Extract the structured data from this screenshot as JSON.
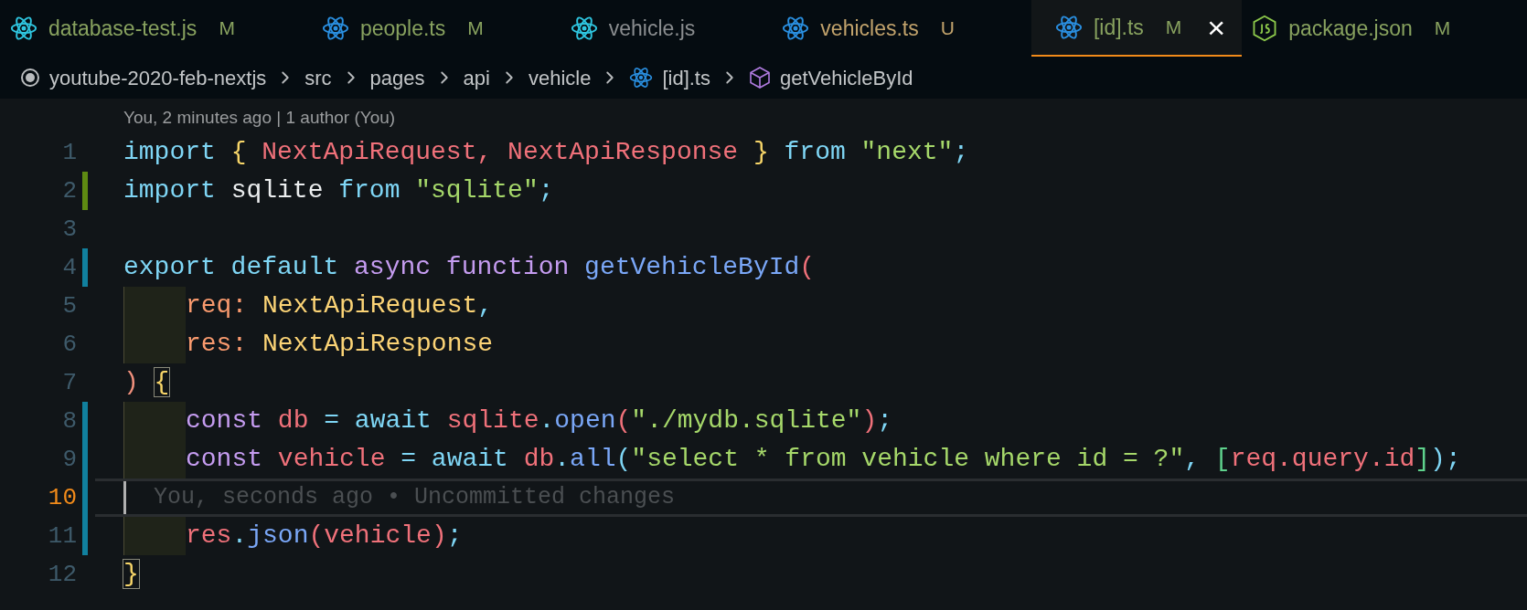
{
  "tabs": [
    {
      "label": "database-test.js",
      "status": "M",
      "kind": "jsx",
      "selected": false
    },
    {
      "label": "people.ts",
      "status": "M",
      "kind": "tsx",
      "selected": false
    },
    {
      "label": "vehicle.js",
      "kind": "jsx",
      "selected": false
    },
    {
      "label": "vehicles.ts",
      "status": "U",
      "kind": "tsx",
      "selected": false
    },
    {
      "label": "[id].ts",
      "status": "M",
      "kind": "tsx",
      "selected": true,
      "close": "×"
    },
    {
      "label": "package.json",
      "status": "M",
      "kind": "node",
      "selected": false
    }
  ],
  "breadcrumb": [
    {
      "label": "youtube-2020-feb-nextjs",
      "kind": "root"
    },
    {
      "label": "src",
      "kind": "folder"
    },
    {
      "label": "pages",
      "kind": "folder"
    },
    {
      "label": "api",
      "kind": "folder"
    },
    {
      "label": "vehicle",
      "kind": "folder"
    },
    {
      "label": "[id].ts",
      "kind": "file"
    },
    {
      "label": "getVehicleById",
      "kind": "symbol"
    }
  ],
  "codelens": "You, 2 minutes ago | 1 author (You)",
  "lines": [
    {
      "number": "1",
      "kind": "unchanged",
      "indented": false,
      "current": false,
      "tokens": [
        {
          "text": "import ",
          "color": "#7fd6f5",
          "matched": false
        },
        {
          "text": "{ ",
          "color": "#f8d669",
          "matched": false
        },
        {
          "text": "NextApiRequest, NextApiResponse ",
          "color": "#f0717a",
          "matched": false
        },
        {
          "text": "} ",
          "color": "#f8d669",
          "matched": false
        },
        {
          "text": "from ",
          "color": "#7fd6f5",
          "matched": false
        },
        {
          "text": "\"next\"",
          "color": "#a6d86a",
          "matched": false
        },
        {
          "text": ";",
          "color": "#7fd6f5",
          "matched": false
        }
      ]
    },
    {
      "number": "2",
      "kind": "added",
      "indented": false,
      "current": false,
      "tokens": [
        {
          "text": "import ",
          "color": "#7fd6f5",
          "matched": false
        },
        {
          "text": "sqlite ",
          "color": "#eceeef",
          "matched": false
        },
        {
          "text": "from ",
          "color": "#7fd6f5",
          "matched": false
        },
        {
          "text": "\"sqlite\"",
          "color": "#a6d86a",
          "matched": false
        },
        {
          "text": ";",
          "color": "#7fd6f5",
          "matched": false
        }
      ]
    },
    {
      "number": "3",
      "kind": "unchanged",
      "indented": false,
      "current": false
    },
    {
      "number": "4",
      "kind": "modified",
      "indented": false,
      "current": false,
      "tokens": [
        {
          "text": "export default ",
          "color": "#7fd6f5",
          "matched": false
        },
        {
          "text": "async function ",
          "color": "#c59cf0",
          "matched": false
        },
        {
          "text": "getVehicleById",
          "color": "#7aa7f7",
          "matched": false
        },
        {
          "text": "(",
          "color": "#f0717a",
          "matched": false
        }
      ]
    },
    {
      "number": "5",
      "kind": "unchanged",
      "indented": true,
      "current": false,
      "tokens": [
        {
          "text": "req: ",
          "color": "#f99a6e",
          "matched": false
        },
        {
          "text": "NextApiRequest",
          "color": "#fcd476",
          "matched": false
        },
        {
          "text": ",",
          "color": "#7fd6f5",
          "matched": false
        }
      ]
    },
    {
      "number": "6",
      "kind": "unchanged",
      "indented": true,
      "current": false,
      "tokens": [
        {
          "text": "res: ",
          "color": "#f99a6e",
          "matched": false
        },
        {
          "text": "NextApiResponse",
          "color": "#fcd476",
          "matched": false
        }
      ]
    },
    {
      "number": "7",
      "kind": "unchanged",
      "indented": false,
      "current": false,
      "tokens": [
        {
          "text": ") ",
          "color": "#f0907c",
          "matched": false
        },
        {
          "text": "{",
          "color": "#f8d669",
          "matched": true
        }
      ]
    },
    {
      "number": "8",
      "kind": "modified",
      "indented": true,
      "current": false,
      "tokens": [
        {
          "text": "const ",
          "color": "#c59cf0",
          "matched": false
        },
        {
          "text": "db ",
          "color": "#f0717a",
          "matched": false
        },
        {
          "text": "= await ",
          "color": "#7fd6f5",
          "matched": false
        },
        {
          "text": "sqlite",
          "color": "#f0717a",
          "matched": false
        },
        {
          "text": ".",
          "color": "#7fd6f5",
          "matched": false
        },
        {
          "text": "open",
          "color": "#7aa7f7",
          "matched": false
        },
        {
          "text": "(",
          "color": "#f0717a",
          "matched": false
        },
        {
          "text": "\"./mydb.sqlite\"",
          "color": "#a6d86a",
          "matched": false
        },
        {
          "text": ")",
          "color": "#f0717a",
          "matched": false
        },
        {
          "text": ";",
          "color": "#7fd6f5",
          "matched": false
        }
      ]
    },
    {
      "number": "9",
      "kind": "modified",
      "indented": true,
      "current": false,
      "tokens": [
        {
          "text": "const ",
          "color": "#c59cf0",
          "matched": false
        },
        {
          "text": "vehicle ",
          "color": "#f0717a",
          "matched": false
        },
        {
          "text": "= await ",
          "color": "#7fd6f5",
          "matched": false
        },
        {
          "text": "db",
          "color": "#f0717a",
          "matched": false
        },
        {
          "text": ".",
          "color": "#7fd6f5",
          "matched": false
        },
        {
          "text": "all",
          "color": "#7aa7f7",
          "matched": false
        },
        {
          "text": "(",
          "color": "#7fd6f5",
          "matched": false
        },
        {
          "text": "\"select * from vehicle where id = ?\"",
          "color": "#a6d86a",
          "matched": false
        },
        {
          "text": ", ",
          "color": "#7fd6f5",
          "matched": false
        },
        {
          "text": "[",
          "color": "#5fd38d",
          "matched": false
        },
        {
          "text": "req.query.id",
          "color": "#f0717a",
          "matched": false
        },
        {
          "text": "]",
          "color": "#5fd38d",
          "matched": false
        },
        {
          "text": ");",
          "color": "#7fd6f5",
          "matched": false
        }
      ]
    },
    {
      "number": "10",
      "kind": "modified",
      "indented": false,
      "current": true,
      "blame": "You, seconds ago • Uncommitted changes"
    },
    {
      "number": "11",
      "kind": "modified",
      "indented": true,
      "current": false,
      "tokens": [
        {
          "text": "res",
          "color": "#f0717a",
          "matched": false
        },
        {
          "text": ".",
          "color": "#7fd6f5",
          "matched": false
        },
        {
          "text": "json",
          "color": "#7aa7f7",
          "matched": false
        },
        {
          "text": "(vehicle)",
          "color": "#f0717a",
          "matched": false
        },
        {
          "text": ";",
          "color": "#7fd6f5",
          "matched": false
        }
      ]
    },
    {
      "number": "12",
      "kind": "unchanged",
      "indented": false,
      "current": false,
      "tokens": [
        {
          "text": "}",
          "color": "#f8d669",
          "matched": true
        }
      ]
    }
  ]
}
